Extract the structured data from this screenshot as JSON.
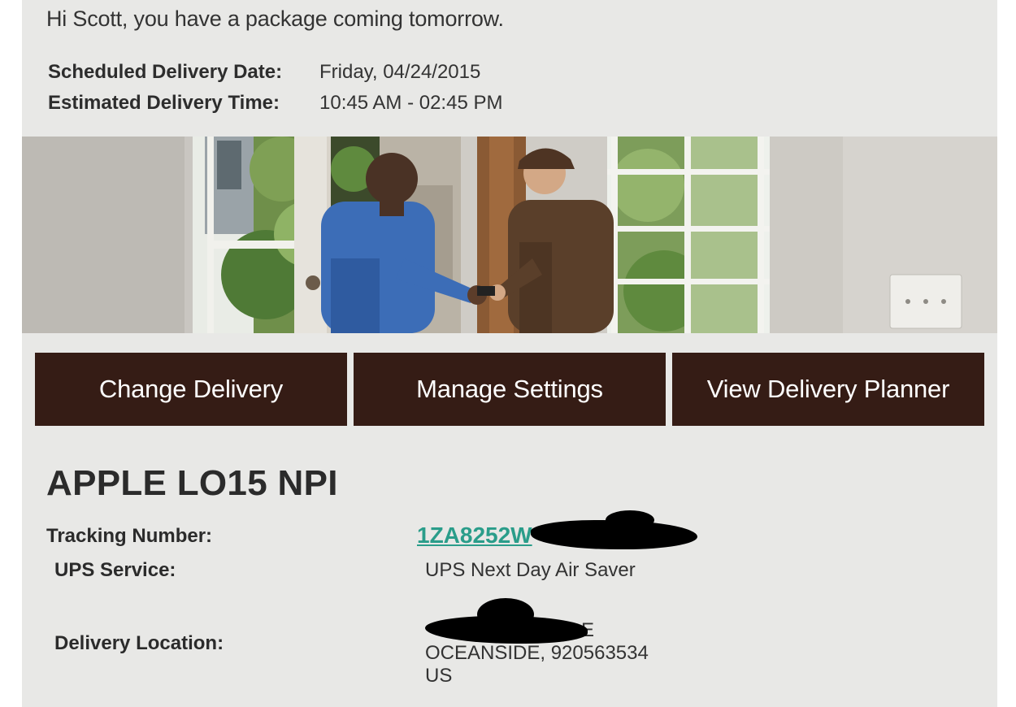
{
  "greeting": "Hi Scott, you have a package coming tomorrow.",
  "schedule": {
    "date_label": "Scheduled Delivery Date:",
    "date_value": "Friday, 04/24/2015",
    "time_label": "Estimated Delivery Time:",
    "time_value": "10:45 AM - 02:45 PM"
  },
  "hero": {
    "alt": "UPS driver delivering a package at a front door",
    "brand_color": "#351c15"
  },
  "buttons": {
    "change_delivery": "Change Delivery",
    "manage_settings": "Manage Settings",
    "view_planner": "View Delivery Planner"
  },
  "package": {
    "title": "APPLE LO15 NPI",
    "tracking_label": "Tracking Number:",
    "tracking_value": "1ZA8252W",
    "service_label": "UPS Service:",
    "service_value": "UPS Next Day Air Saver",
    "location_label": "Delivery Location:",
    "address_line1_partial": "E",
    "address_city": "OCEANSIDE, 920563534",
    "address_country": "US"
  },
  "colors": {
    "background": "#e8e8e6",
    "button_bg": "#351c15",
    "link": "#2a9d8a"
  }
}
